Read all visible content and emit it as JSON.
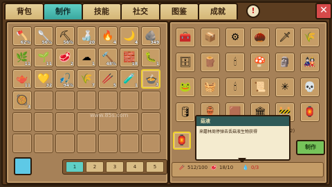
{
  "tabs": [
    "背包",
    "制作",
    "技能",
    "社交",
    "图鉴",
    "成就"
  ],
  "active_tab_index": 1,
  "alert_icon": "!",
  "close_icon": "✕",
  "watermark_text": "www.85s.com",
  "left_slots": [
    {
      "icon": "axe-icon",
      "glyph": "🪓",
      "count": "62%"
    },
    {
      "icon": "shovel-icon",
      "glyph": "🥄",
      "count": "56%"
    },
    {
      "icon": "pickaxe-icon",
      "glyph": "⛏",
      "count": "56%"
    },
    {
      "icon": "bottle-icon",
      "glyph": "🍶",
      "count": "20"
    },
    {
      "icon": "torch-icon",
      "glyph": "🔥",
      "count": "4"
    },
    {
      "icon": "sickle-icon",
      "glyph": "🌙",
      "count": "4"
    },
    {
      "icon": "stone-icon",
      "glyph": "🪨",
      "count": "349"
    },
    {
      "icon": "herb-icon",
      "glyph": "🌿",
      "count": "11"
    },
    {
      "icon": "sapling-icon",
      "glyph": "🌱",
      "count": "11"
    },
    {
      "icon": "meat-icon",
      "glyph": "🥩",
      "count": "2"
    },
    {
      "icon": "wool-icon",
      "glyph": "☁",
      "count": "1"
    },
    {
      "icon": "hammer-icon",
      "glyph": "🔨",
      "count": "48%"
    },
    {
      "icon": "brick-icon",
      "glyph": "🧱",
      "count": "18"
    },
    {
      "icon": "worm-icon",
      "glyph": "🐛",
      "count": "1"
    },
    {
      "icon": "kettle-icon",
      "glyph": "🫖",
      "count": "11"
    },
    {
      "icon": "ore-icon",
      "glyph": "💛",
      "count": "32"
    },
    {
      "icon": "fishing-rod-icon",
      "glyph": "🎣",
      "count": "94%"
    },
    {
      "icon": "grass-icon",
      "glyph": "🌾",
      "count": "7"
    },
    {
      "icon": "stick-icon",
      "glyph": "🥢",
      "count": "5"
    },
    {
      "icon": "potion-icon",
      "glyph": "🧪",
      "count": "1"
    },
    {
      "icon": "pot-icon",
      "glyph": "🍲",
      "count": "3"
    },
    {
      "icon": "cauldron-icon",
      "glyph": "🥘",
      "count": "3"
    }
  ],
  "right_slots": [
    {
      "icon": "chest-icon",
      "glyph": "🧰"
    },
    {
      "icon": "crate-icon",
      "glyph": "📦"
    },
    {
      "icon": "gear-cluster-icon",
      "glyph": "⚙"
    },
    {
      "icon": "seeds-icon",
      "glyph": "🌰"
    },
    {
      "icon": "sword-icon",
      "glyph": "🗡"
    },
    {
      "icon": "wheat-icon",
      "glyph": "🌾"
    },
    {
      "icon": "cabinet-icon",
      "glyph": "🗄"
    },
    {
      "icon": "planks-icon",
      "glyph": "🪵"
    },
    {
      "icon": "candle-icon",
      "glyph": "🕯"
    },
    {
      "icon": "mushroom-lamp-icon",
      "glyph": "🍄"
    },
    {
      "icon": "statue-icon",
      "glyph": "🗿"
    },
    {
      "icon": "totem-icon",
      "glyph": "🎎"
    },
    {
      "icon": "frog-icon",
      "glyph": "🐸"
    },
    {
      "icon": "cage-icon",
      "glyph": "🧺"
    },
    {
      "icon": "candle-flame-icon",
      "glyph": "🕯"
    },
    {
      "icon": "scroll-icon",
      "glyph": "📜"
    },
    {
      "icon": "rune-icon",
      "glyph": "✳"
    },
    {
      "icon": "skull-icon",
      "glyph": "💀"
    },
    {
      "icon": "barrel-icon",
      "glyph": "🛢"
    },
    {
      "icon": "vase-icon",
      "glyph": "🏺"
    },
    {
      "icon": "wood-block-icon",
      "glyph": "🟫"
    },
    {
      "icon": "pillar-icon",
      "glyph": "🏛"
    },
    {
      "icon": "fence-icon",
      "glyph": "🚧"
    },
    {
      "icon": "lantern-icon",
      "glyph": "🏮"
    }
  ],
  "selected_recipe_glyph": "🏮",
  "tooltip": {
    "title": "菇液",
    "body": "来蘑林周停弹去丢菇液生物获得"
  },
  "side_count": "2)",
  "craft_label": "制作",
  "materials": [
    {
      "icon": "stick-icon",
      "glyph": "🥢",
      "amount": "512/100"
    },
    {
      "icon": "meat-icon",
      "glyph": "🥩",
      "amount": "18/10"
    },
    {
      "icon": "drop-icon",
      "glyph": "💧",
      "amount": "0/3"
    }
  ],
  "pages": [
    "1",
    "2",
    "3",
    "4",
    "5"
  ],
  "active_page_index": 0
}
